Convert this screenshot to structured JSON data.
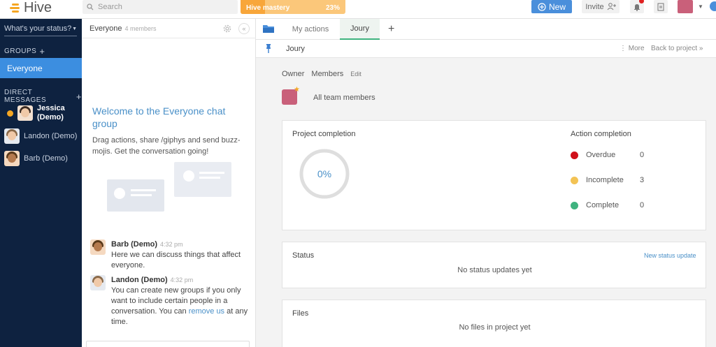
{
  "app": {
    "name": "Hive"
  },
  "search": {
    "placeholder": "Search"
  },
  "mastery": {
    "label": "Hive mastery",
    "percent_text": "23%",
    "progress": 0.23
  },
  "header": {
    "new_label": "New",
    "invite_label": "Invite"
  },
  "sidebar": {
    "status_placeholder": "What's your status?",
    "groups_heading": "GROUPS",
    "groups": [
      {
        "label": "Everyone"
      }
    ],
    "dm_heading": "DIRECT MESSAGES",
    "dms": [
      {
        "label": "Jessica (Demo)"
      },
      {
        "label": "Landon (Demo)"
      },
      {
        "label": "Barb (Demo)"
      }
    ]
  },
  "chat": {
    "title": "Everyone",
    "members": "4 members",
    "welcome_title": "Welcome to the Everyone chat group",
    "welcome_sub": "Drag actions, share /giphys and send buzz-mojis. Get the conversation going!",
    "messages": [
      {
        "name": "Barb (Demo)",
        "time": "4:32 pm",
        "text": "Here we can discuss things that affect everyone."
      },
      {
        "name": "Landon (Demo)",
        "time": "4:32 pm",
        "text": "You can create new groups if you only want to include certain people in a conversation. You can ",
        "link": "remove us",
        "text_after": " at any time."
      }
    ]
  },
  "tabs": [
    {
      "label": "My actions"
    },
    {
      "label": "Joury"
    }
  ],
  "project": {
    "name": "Joury",
    "more_label": "More",
    "back_label": "Back to project »",
    "owner_label": "Owner",
    "members_label": "Members",
    "edit_label": "Edit",
    "team_label": "All team members"
  },
  "completion": {
    "title": "Project completion",
    "percent_text": "0%",
    "action_title": "Action completion",
    "actions": [
      {
        "label": "Overdue",
        "count": "0",
        "color": "#d0101a"
      },
      {
        "label": "Incomplete",
        "count": "3",
        "color": "#f3c354"
      },
      {
        "label": "Complete",
        "count": "0",
        "color": "#3fb37f"
      }
    ]
  },
  "status_card": {
    "title": "Status",
    "link": "New status update",
    "empty": "No status updates yet"
  },
  "files_card": {
    "title": "Files",
    "empty": "No files in project yet"
  }
}
